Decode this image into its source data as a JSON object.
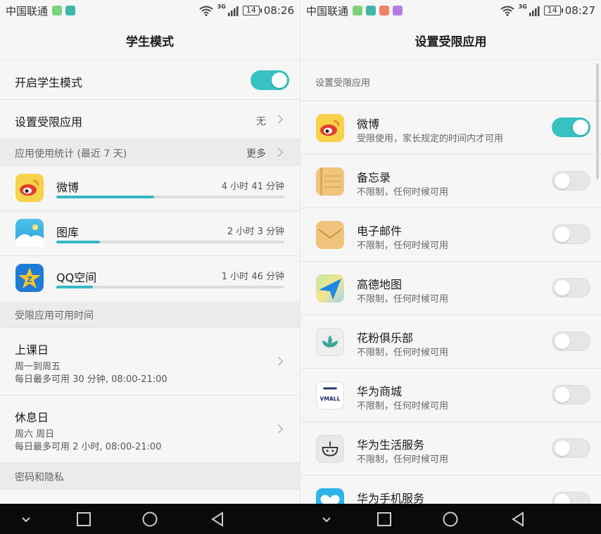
{
  "status": {
    "carrier": "中国联通",
    "network": "3G",
    "battery": "14",
    "time_left": "08:26",
    "time_right": "08:27"
  },
  "left": {
    "title": "学生模式",
    "enable": {
      "label": "开启学生模式",
      "enabled": true
    },
    "restricted": {
      "label": "设置受限应用",
      "value": "无"
    },
    "usage_header": {
      "label": "应用使用统计 (最近 7 天)",
      "more": "更多"
    },
    "usage": [
      {
        "name": "微博",
        "time": "4 小时 41 分钟",
        "fraction": 0.43
      },
      {
        "name": "图库",
        "time": "2 小时 3 分钟",
        "fraction": 0.19
      },
      {
        "name": "QQ空间",
        "time": "1 小时 46 分钟",
        "fraction": 0.16
      }
    ],
    "time_header": "受限应用可用时间",
    "weekday": {
      "title": "上课日",
      "days": "周一到周五",
      "limit": "每日最多可用 30 分钟, 08:00-21:00"
    },
    "weekend": {
      "title": "休息日",
      "days": "周六 周日",
      "limit": "每日最多可用 2 小时, 08:00-21:00"
    },
    "privacy_header": "密码和隐私"
  },
  "right": {
    "title": "设置受限应用",
    "header": "设置受限应用",
    "apps": [
      {
        "name": "微博",
        "desc": "受限使用，家长规定的时间内才可用",
        "enabled": true
      },
      {
        "name": "备忘录",
        "desc": "不限制，任何时候可用",
        "enabled": false
      },
      {
        "name": "电子邮件",
        "desc": "不限制，任何时候可用",
        "enabled": false
      },
      {
        "name": "高德地图",
        "desc": "不限制，任何时候可用",
        "enabled": false
      },
      {
        "name": "花粉俱乐部",
        "desc": "不限制，任何时候可用",
        "enabled": false
      },
      {
        "name": "华为商城",
        "desc": "不限制，任何时候可用",
        "enabled": false
      },
      {
        "name": "华为生活服务",
        "desc": "不限制，任何时候可用",
        "enabled": false
      },
      {
        "name": "华为手机服务",
        "desc": "",
        "enabled": false
      }
    ],
    "vmall_logo": "VMALL"
  },
  "icons": {
    "weibo": "weibo-icon",
    "gallery": "gallery-icon",
    "qzone": "qzone-icon",
    "notepad": "notepad-icon",
    "email": "email-icon",
    "amap": "amap-icon",
    "club": "lotus-icon",
    "vmall": "vmall-icon",
    "life": "life-service-icon",
    "phone_service": "heart-icon"
  },
  "colors": {
    "accent": "#37c1c1",
    "bar": "#37b8c4"
  }
}
